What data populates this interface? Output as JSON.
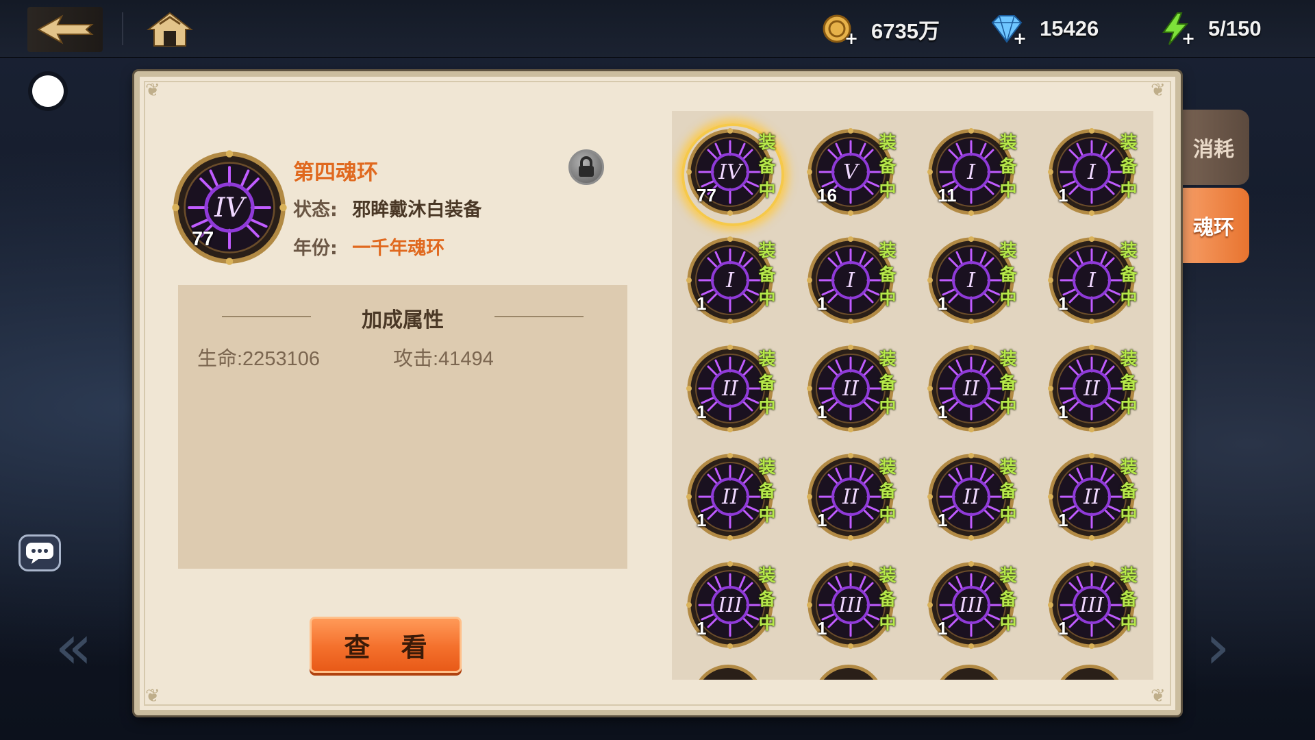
{
  "resources": [
    {
      "icon": "gold-coin-icon",
      "value": "6735万"
    },
    {
      "icon": "diamond-icon",
      "value": "15426"
    },
    {
      "icon": "energy-icon",
      "value": "5/150"
    }
  ],
  "detail": {
    "title": "第四魂环",
    "roman": "IV",
    "level": "77",
    "status_label": "状态:",
    "status_value": "邪眸戴沐白装备",
    "year_label": "年份:",
    "year_value": "一千年魂环",
    "attr_title": "加成属性",
    "hp": "生命:2253106",
    "atk": "攻击:41494",
    "view_button": "查 看"
  },
  "equip_label": [
    "装",
    "备",
    "中"
  ],
  "rings": [
    {
      "roman": "IV",
      "level": "77",
      "selected": true
    },
    {
      "roman": "V",
      "level": "16"
    },
    {
      "roman": "I",
      "level": "11"
    },
    {
      "roman": "I",
      "level": "1"
    },
    {
      "roman": "I",
      "level": "1"
    },
    {
      "roman": "I",
      "level": "1"
    },
    {
      "roman": "I",
      "level": "1"
    },
    {
      "roman": "I",
      "level": "1"
    },
    {
      "roman": "II",
      "level": "1"
    },
    {
      "roman": "II",
      "level": "1"
    },
    {
      "roman": "II",
      "level": "1"
    },
    {
      "roman": "II",
      "level": "1"
    },
    {
      "roman": "II",
      "level": "1"
    },
    {
      "roman": "II",
      "level": "1"
    },
    {
      "roman": "II",
      "level": "1"
    },
    {
      "roman": "II",
      "level": "1"
    },
    {
      "roman": "III",
      "level": "1"
    },
    {
      "roman": "III",
      "level": "1"
    },
    {
      "roman": "III",
      "level": "1"
    },
    {
      "roman": "III",
      "level": "1"
    }
  ],
  "tabs": {
    "consume": "消耗",
    "ring": "魂环"
  },
  "colors": {
    "accent": "#e0691f",
    "equip_green": "#b6e84a",
    "ring_purple": "#b94cff"
  }
}
